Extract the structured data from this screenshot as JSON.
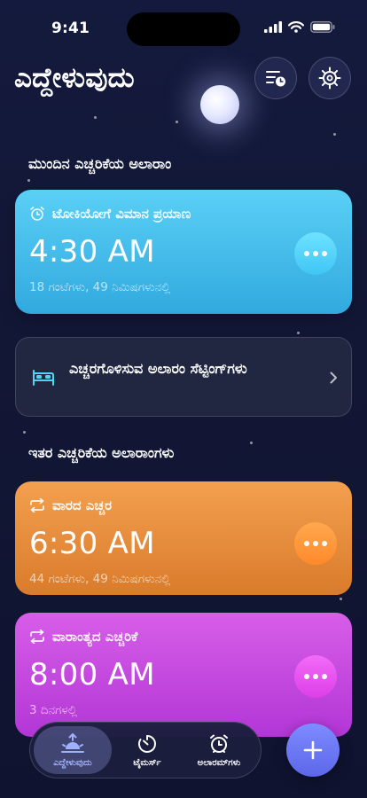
{
  "status_bar": {
    "time": "9:41"
  },
  "header": {
    "title": "ಎದ್ದೇಳುವುದು",
    "schedule_icon": "list-clock-icon",
    "settings_icon": "gear-icon"
  },
  "next_section": {
    "title": "ಮುಂದಿನ ಎಚ್ಚರಿಕೆಯ ಅಲಾರಾಂ",
    "card": {
      "icon": "alarm-clock-icon",
      "label": "ಟೋಕಿಯೋಗೆ ವಿಮಾನ ಪ್ರಯಾಣ",
      "time": "4:30 AM",
      "remaining": "18 ಗಂಟೆಗಳು, 49 ನಿಮಿಷಗಳುನಲ್ಲಿ",
      "color": "#3db8e8"
    }
  },
  "settings_card": {
    "icon": "bed-icon",
    "label": "ಎಚ್ಚರಗೊಳಿಸುವ ಅಲಾರಂ ಸೆಟ್ಟಿಂಗ್‌ಗಳು"
  },
  "other_section": {
    "title": "ಇತರ ಎಚ್ಚರಿಕೆಯ ಅಲಾರಾಂಗಳು",
    "cards": [
      {
        "icon": "repeat-icon",
        "label": "ವಾರದ ಎಚ್ಚರ",
        "time": "6:30 AM",
        "remaining": "44 ಗಂಟೆಗಳು, 49 ನಿಮಿಷಗಳುನಲ್ಲಿ",
        "color": "#e58a3a"
      },
      {
        "icon": "repeat-icon",
        "label": "ವಾರಾಂತ್ಯದ ಎಚ್ಚರಿಕೆ",
        "time": "8:00 AM",
        "remaining": "3 ದಿನಗಳಲ್ಲಿ",
        "color": "#c548e0"
      }
    ]
  },
  "bottom_nav": {
    "items": [
      {
        "label": "ಎದ್ದೇಳುವುದು",
        "icon": "sunrise-icon",
        "active": true
      },
      {
        "label": "ಟೈಮರ್ಸ್",
        "icon": "timer-icon",
        "active": false
      },
      {
        "label": "ಅಲಾರಮ್‌ಗಳು",
        "icon": "alarm-clock-icon",
        "active": false
      }
    ],
    "add_icon": "plus-icon"
  }
}
